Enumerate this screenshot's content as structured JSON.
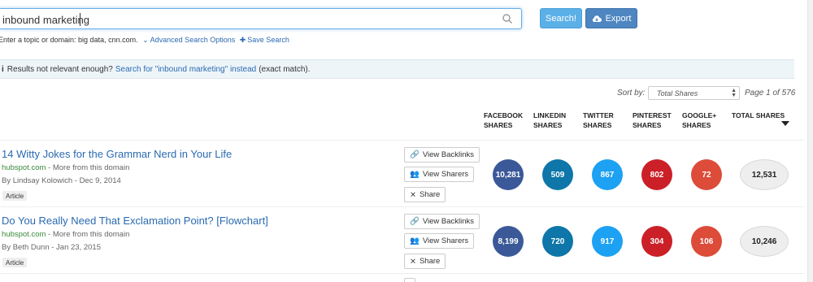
{
  "search": {
    "value": "inbound marketing",
    "search_button": "Search!",
    "export_button": "Export",
    "hint": "Enter a topic or domain: big data, cnn.com.",
    "advanced_link": "Advanced Search Options",
    "save_link": "Save Search"
  },
  "notice": {
    "prefix": "Results not relevant enough?",
    "link": "Search for \"inbound marketing\" instead",
    "suffix": "(exact match)."
  },
  "sort": {
    "label": "Sort by:",
    "selected": "Total Shares",
    "page_info": "Page 1 of 576"
  },
  "columns": [
    {
      "line1": "FACEBOOK",
      "line2": "SHARES"
    },
    {
      "line1": "LINKEDIN",
      "line2": "SHARES"
    },
    {
      "line1": "TWITTER",
      "line2": "SHARES"
    },
    {
      "line1": "PINTEREST",
      "line2": "SHARES"
    },
    {
      "line1": "GOOGLE+",
      "line2": "SHARES"
    },
    {
      "line1": "TOTAL SHARES",
      "line2": ""
    }
  ],
  "actions": {
    "backlinks": "View Backlinks",
    "sharers": "View Sharers",
    "share": "Share"
  },
  "colors": {
    "facebook": "#3b5998",
    "linkedin": "#0e76a8",
    "twitter": "#1da1f2",
    "pinterest": "#cb2027",
    "google": "#dd4b39"
  },
  "results": [
    {
      "title": "14 Witty Jokes for the Grammar Nerd in Your Life",
      "domain": "hubspot.com",
      "more": "- More from this domain",
      "byline": "By Lindsay Kolowich - Dec 9, 2014",
      "tag": "Article",
      "facebook": "10,281",
      "linkedin": "509",
      "twitter": "867",
      "pinterest": "802",
      "google": "72",
      "total": "12,531"
    },
    {
      "title": "Do You Really Need That Exclamation Point? [Flowchart]",
      "domain": "hubspot.com",
      "more": "- More from this domain",
      "byline": "By Beth Dunn - Jan 23, 2015",
      "tag": "Article",
      "facebook": "8,199",
      "linkedin": "720",
      "twitter": "917",
      "pinterest": "304",
      "google": "106",
      "total": "10,246"
    }
  ]
}
